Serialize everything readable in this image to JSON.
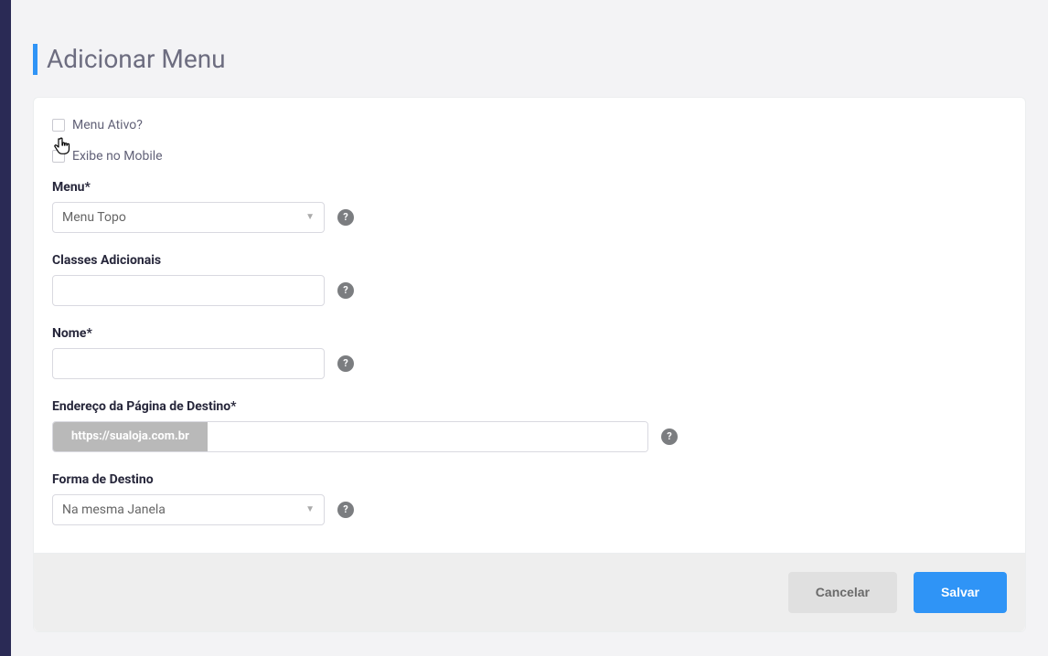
{
  "page": {
    "title": "Adicionar Menu"
  },
  "checkboxes": {
    "menu_ativo": {
      "label": "Menu Ativo?",
      "checked": false
    },
    "exibe_mobile": {
      "label": "Exibe no Mobile",
      "checked": false
    }
  },
  "fields": {
    "menu": {
      "label": "Menu*",
      "selected": "Menu Topo"
    },
    "classes": {
      "label": "Classes Adicionais",
      "value": ""
    },
    "nome": {
      "label": "Nome*",
      "value": ""
    },
    "endereco": {
      "label": "Endereço da Página de Destino*",
      "prefix": "https://sualoja.com.br",
      "value": ""
    },
    "destino": {
      "label": "Forma de Destino",
      "selected": "Na mesma Janela"
    }
  },
  "buttons": {
    "cancel": "Cancelar",
    "save": "Salvar"
  },
  "help_glyph": "?"
}
